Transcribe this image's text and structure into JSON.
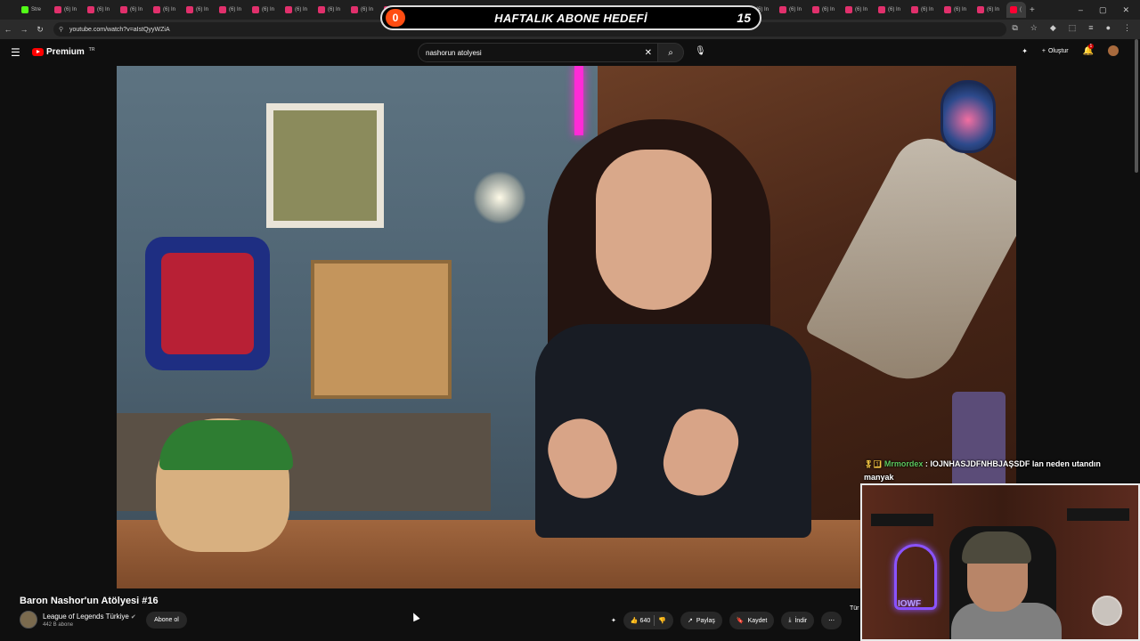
{
  "browser": {
    "tabs": [
      {
        "label": "Stre"
      },
      {
        "label": "(6) In"
      },
      {
        "label": "(6) In"
      },
      {
        "label": "(6) In"
      },
      {
        "label": "(6) In"
      },
      {
        "label": "(6) In"
      },
      {
        "label": "(6) In"
      },
      {
        "label": "(6) In"
      },
      {
        "label": "(6) In"
      },
      {
        "label": "(6) In"
      },
      {
        "label": "(6) In"
      },
      {
        "label": "(6) In"
      },
      {
        "label": "(6) In"
      },
      {
        "label": "(6) In"
      },
      {
        "label": "(6) In"
      },
      {
        "label": "(6) In"
      },
      {
        "label": "(6) In"
      },
      {
        "label": "(6) In"
      },
      {
        "label": "(6) In"
      },
      {
        "label": "(6) In"
      },
      {
        "label": "(6) In"
      },
      {
        "label": "(6) In"
      },
      {
        "label": "(6) In"
      },
      {
        "label": "(6) In"
      },
      {
        "label": "(6) In"
      },
      {
        "label": "(6) In"
      },
      {
        "label": "(6) In"
      },
      {
        "label": "(6) In"
      },
      {
        "label": "(6) In"
      },
      {
        "label": "(6) In"
      }
    ],
    "active_tab_label": "(",
    "new_tab": "+",
    "url": "youtube.com/watch?v=aIstQyyWZiA",
    "window_controls": [
      "–",
      "▢",
      "✕"
    ]
  },
  "goal_overlay": {
    "current": "0",
    "title": "HAFTALIK ABONE HEDEFİ",
    "target": "15",
    "progress_fraction": 0
  },
  "youtube": {
    "logo_text": "Premium",
    "region": "TR",
    "search_value": "nashorun atolyesi",
    "create_label": "Oluştur",
    "notification_count": "1"
  },
  "chat_overlay": {
    "badges": "🎖1⃣",
    "username": "Mrmordex",
    "message": " : IOJNHASJDFNHBJAŞSDF lan neden utandın manyak"
  },
  "webcam": {
    "neon_text": "IOWF"
  },
  "video_info": {
    "title": "Baron Nashor'un Atölyesi #16",
    "channel_name": "League of Legends Türkiye",
    "subscribers": "442 B abone",
    "subscribe_label": "Abone ol",
    "like_count": "640",
    "share_label": "Paylaş",
    "save_label": "Kaydet",
    "download_label": "İndir",
    "language_label": "Tür"
  },
  "colors": {
    "accent_red": "#ff0000",
    "goal_orange": "#ff4d12",
    "chat_username": "#5ec85e"
  }
}
